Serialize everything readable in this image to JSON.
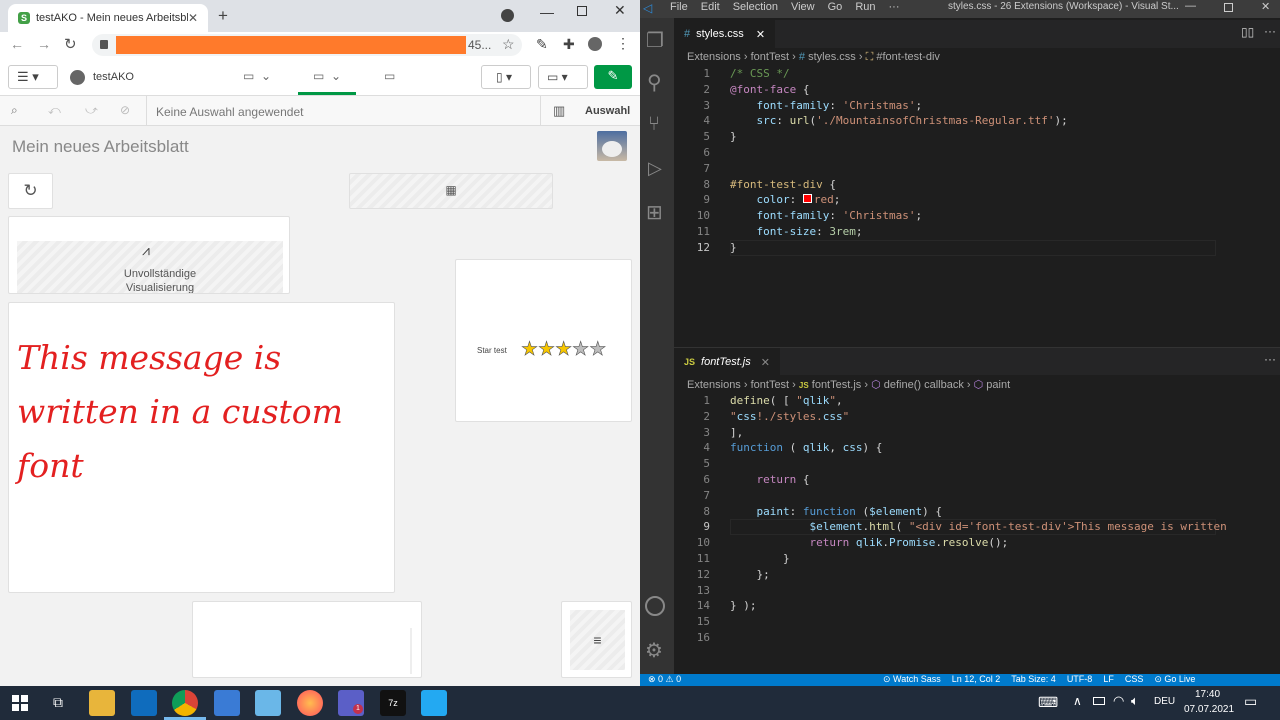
{
  "chrome": {
    "tab_title": "testAKO - Mein neues Arbeitsblatt",
    "url_suffix": "45...",
    "app_name": "testAKO",
    "selection_text": "Keine Auswahl angewendet",
    "selection_label": "Auswahl",
    "sheet_title": "Mein neues Arbeitsblatt",
    "incomplete_viz": "Unvollständige Visualisierung",
    "custom_font_message": "This message is written in a custom font",
    "star_label": "Star test",
    "star_rating": 3,
    "star_max": 5,
    "accent_color": "#009845",
    "font_color": "#e32020"
  },
  "vscode": {
    "menu": [
      "File",
      "Edit",
      "Selection",
      "View",
      "Go",
      "Run",
      "···"
    ],
    "window_title": "styles.css - 26 Extensions (Workspace) - Visual St...",
    "tab1": "styles.css",
    "breadcrumb1": [
      "Extensions",
      "fontTest",
      "styles.css",
      "#font-test-div"
    ],
    "css_lines": [
      "/* CSS */",
      "@font-face {",
      "    font-family: 'Christmas';",
      "    src: url('./MountainsofChristmas-Regular.ttf');",
      "}",
      "",
      "",
      "#font-test-div {",
      "    color: red;",
      "    font-family: 'Christmas';",
      "    font-size: 3rem;",
      "}"
    ],
    "tab2": "fontTest.js",
    "breadcrumb2": [
      "Extensions",
      "fontTest",
      "fontTest.js",
      "define() callback",
      "paint"
    ],
    "js_lines": [
      "define( [ \"qlik\",",
      "\"css!./styles.css\"",
      "],",
      "function ( qlik, css) {",
      "",
      "    return {",
      "",
      "    paint: function ($element) {",
      "            $element.html( \"<div id='font-test-div'>This message is written",
      "            return qlik.Promise.resolve();",
      "        }",
      "    };",
      "",
      "} );",
      "",
      ""
    ],
    "status_left": "⊗ 0 ⚠ 0",
    "status_items": [
      "⊙ Watch Sass",
      "Ln 12, Col 2",
      "Tab Size: 4",
      "UTF-8",
      "LF",
      "CSS",
      "⊙ Go Live"
    ]
  },
  "taskbar": {
    "time": "17:40",
    "date": "07.07.2021",
    "lang": "DEU",
    "teams_badge": "1"
  }
}
